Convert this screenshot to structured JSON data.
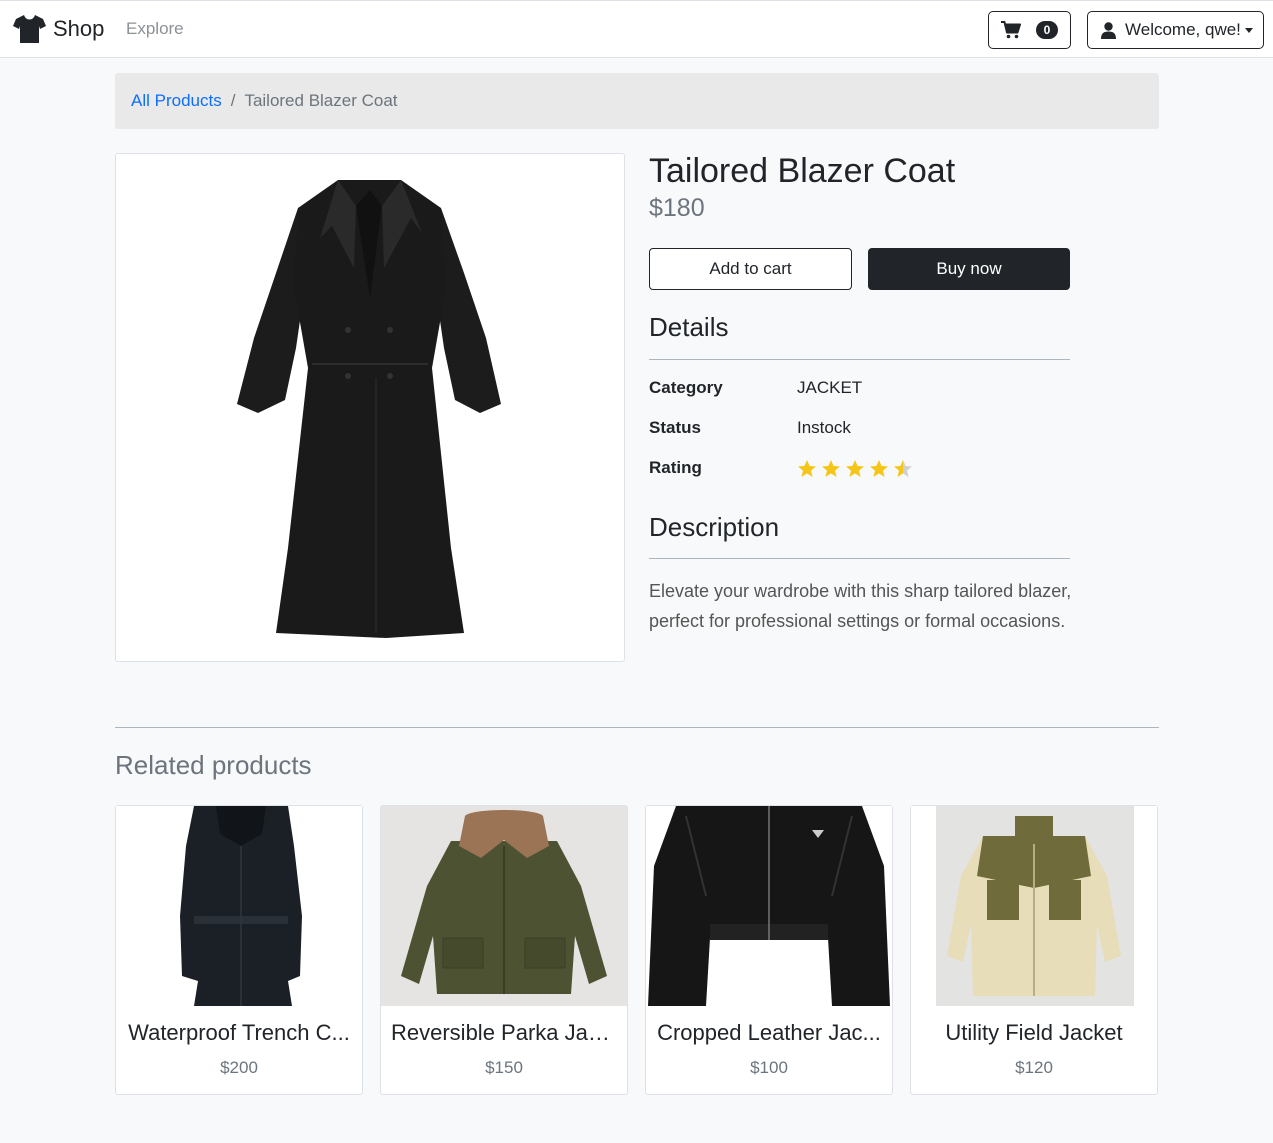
{
  "navbar": {
    "brand": "Shop",
    "brand_icon": "tshirt-icon",
    "explore": "Explore",
    "cart_icon": "cart-icon",
    "cart_count": "0",
    "user_icon": "user-icon",
    "user_label": "Welcome, qwe!"
  },
  "breadcrumb": {
    "root": "All Products",
    "separator": "/",
    "current": "Tailored Blazer Coat"
  },
  "product": {
    "title": "Tailored Blazer Coat",
    "price": "$180",
    "add_to_cart": "Add to cart",
    "buy_now": "Buy now",
    "details_heading": "Details",
    "details": [
      {
        "label": "Category",
        "value": "JACKET"
      },
      {
        "label": "Status",
        "value": "Instock"
      },
      {
        "label": "Rating",
        "value": ""
      }
    ],
    "rating": 4.5,
    "rating_max": 5,
    "description_heading": "Description",
    "description": "Elevate your wardrobe with this sharp tailored blazer, perfect for professional settings or formal occasions."
  },
  "related": {
    "heading": "Related products",
    "items": [
      {
        "title": "Waterproof Trench C...",
        "price": "$200"
      },
      {
        "title": "Reversible Parka Jacket",
        "price": "$150"
      },
      {
        "title": "Cropped Leather Jac...",
        "price": "$100"
      },
      {
        "title": "Utility Field Jacket",
        "price": "$120"
      }
    ]
  },
  "colors": {
    "primary_dark": "#212529",
    "link": "#0d6efd",
    "muted": "#6c757d",
    "star": "#f5c518",
    "background": "#f8f9fa"
  }
}
